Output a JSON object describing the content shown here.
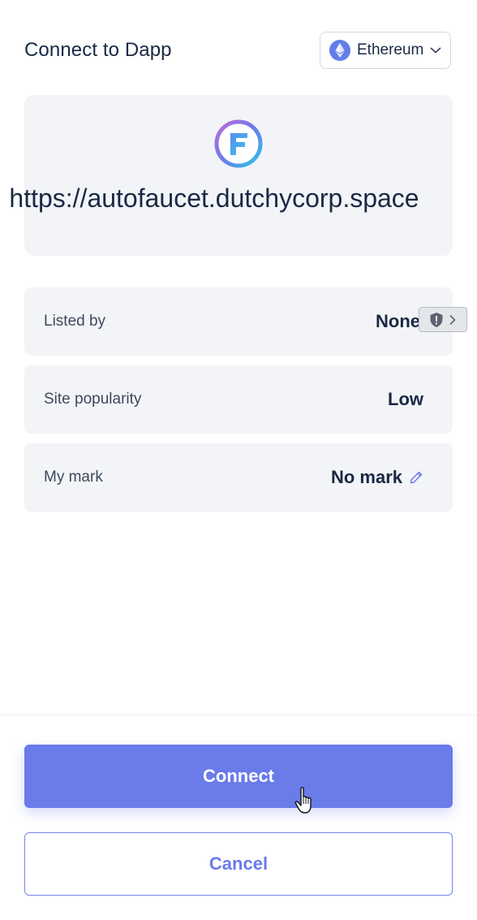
{
  "header": {
    "title": "Connect to Dapp",
    "chain_select": {
      "label": "Ethereum",
      "icon": "ethereum-icon"
    }
  },
  "site": {
    "logo": "faucet-logo-icon",
    "url": "https://autofaucet.dutchycorp.space"
  },
  "details": {
    "listed_by": {
      "label": "Listed by",
      "value": "None"
    },
    "site_popularity": {
      "label": "Site popularity",
      "value": "Low"
    },
    "my_mark": {
      "label": "My mark",
      "value": "No mark"
    }
  },
  "actions": {
    "connect_label": "Connect",
    "cancel_label": "Cancel"
  },
  "colors": {
    "accent": "#6a7bea",
    "card_bg": "#f2f4f7",
    "text_primary": "#192945"
  }
}
